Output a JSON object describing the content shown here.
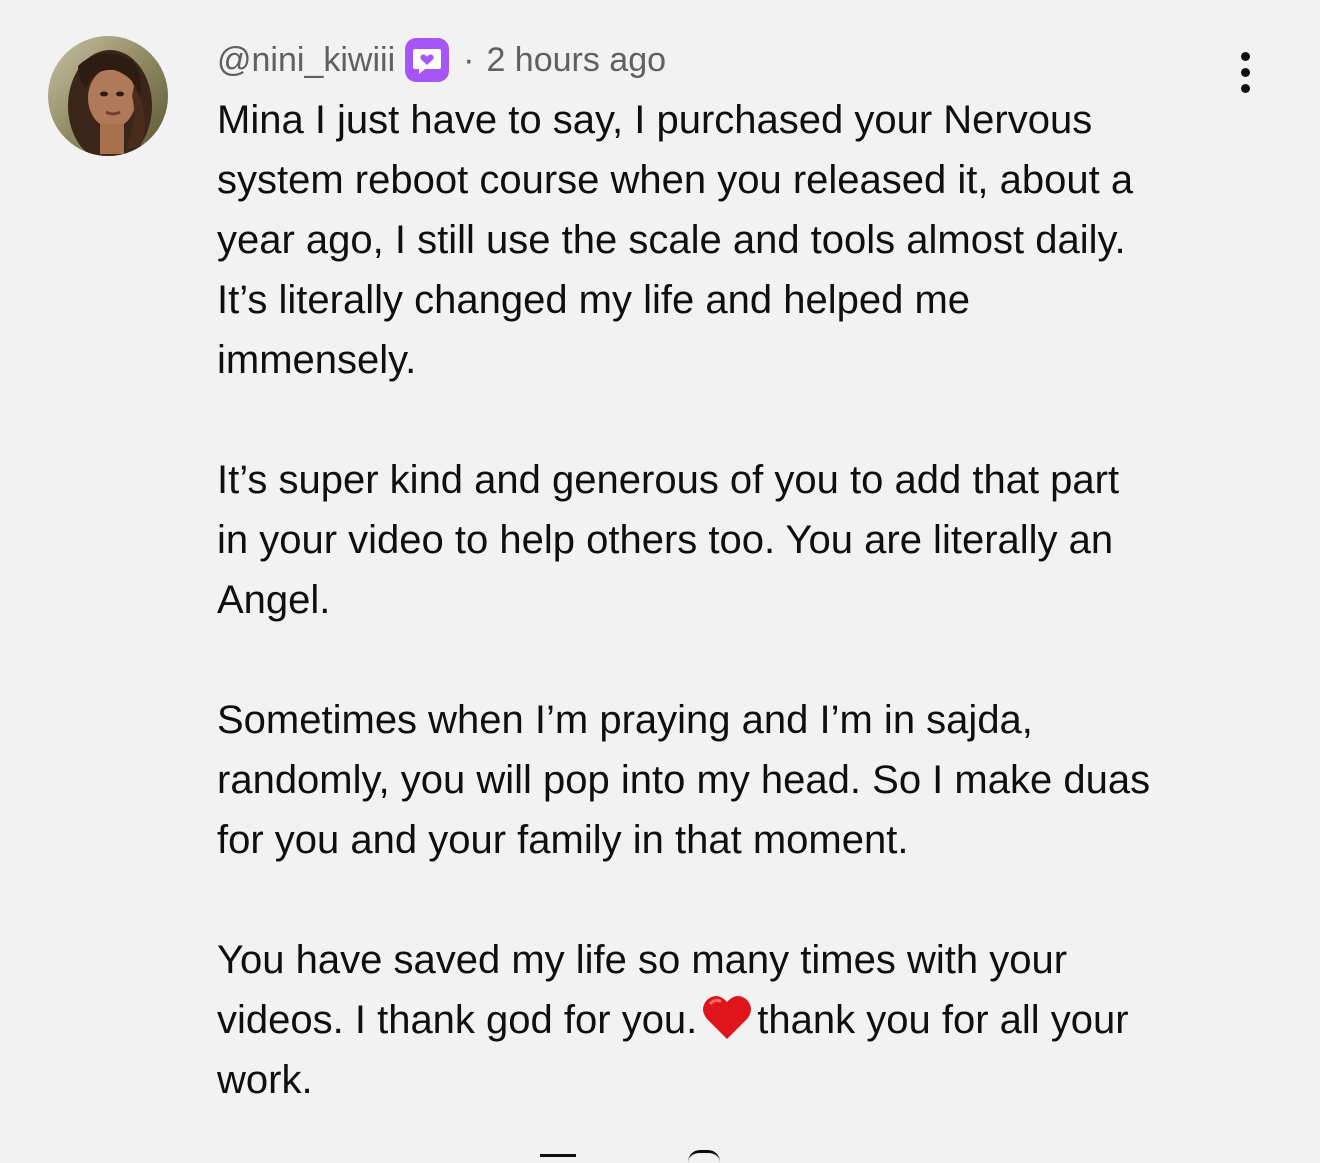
{
  "comment": {
    "avatar_icon": "user-avatar-photo",
    "username": "@nini_kiwiii",
    "badge_icon": "member-heart-badge-icon",
    "badge_color": "#a855f7",
    "separator": "·",
    "timestamp": "2 hours ago",
    "more_icon": "vertical-ellipsis-icon",
    "lines": [
      "Mina I just have to say, I purchased your Nervous",
      "system reboot course when you released it, about a",
      "year ago, I still use the scale and tools almost daily.",
      "It’s literally changed my life and helped me",
      "immensely.",
      "",
      "It’s super kind and generous of you to add that part",
      "in your video to help others too. You are literally an",
      "Angel.",
      "",
      "Sometimes when I’m praying and I’m in sajda,",
      "randomly, you will pop into my head. So I make duas",
      "for you and your family in that moment.",
      "",
      "You have saved my life so many times with your"
    ],
    "heart_line_before": "videos. I thank god for you.",
    "heart_emoji": "❤️",
    "heart_line_after": "thank you for all your",
    "last_line": "work."
  }
}
